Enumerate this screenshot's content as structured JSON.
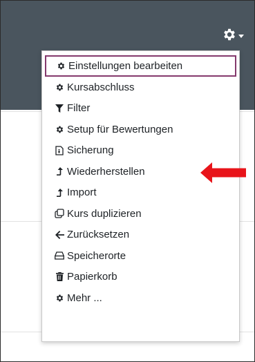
{
  "colors": {
    "header_bg": "#4a555e",
    "active_border": "#84396c",
    "arrow": "#e8141a",
    "text": "#1d2125"
  },
  "header": {
    "settings_icon": "gear-icon",
    "caret_icon": "caret-down-icon"
  },
  "menu": {
    "items": [
      {
        "label": "Einstellungen bearbeiten",
        "icon": "gear-icon",
        "active": true
      },
      {
        "label": "Kursabschluss",
        "icon": "gear-icon"
      },
      {
        "label": "Filter",
        "icon": "filter-icon"
      },
      {
        "label": "Setup für Bewertungen",
        "icon": "gear-icon"
      },
      {
        "label": "Sicherung",
        "icon": "backup-file-icon"
      },
      {
        "label": "Wiederherstellen",
        "icon": "level-up-icon"
      },
      {
        "label": "Import",
        "icon": "level-up-icon"
      },
      {
        "label": "Kurs duplizieren",
        "icon": "copy-icon"
      },
      {
        "label": "Zurücksetzen",
        "icon": "arrow-left-icon"
      },
      {
        "label": "Speicherorte",
        "icon": "hard-drive-icon"
      },
      {
        "label": "Papierkorb",
        "icon": "trash-icon"
      },
      {
        "label": "Mehr ...",
        "icon": "gear-icon"
      }
    ]
  },
  "annotation": {
    "icon": "red-arrow-icon",
    "points_to": "Wiederherstellen"
  }
}
